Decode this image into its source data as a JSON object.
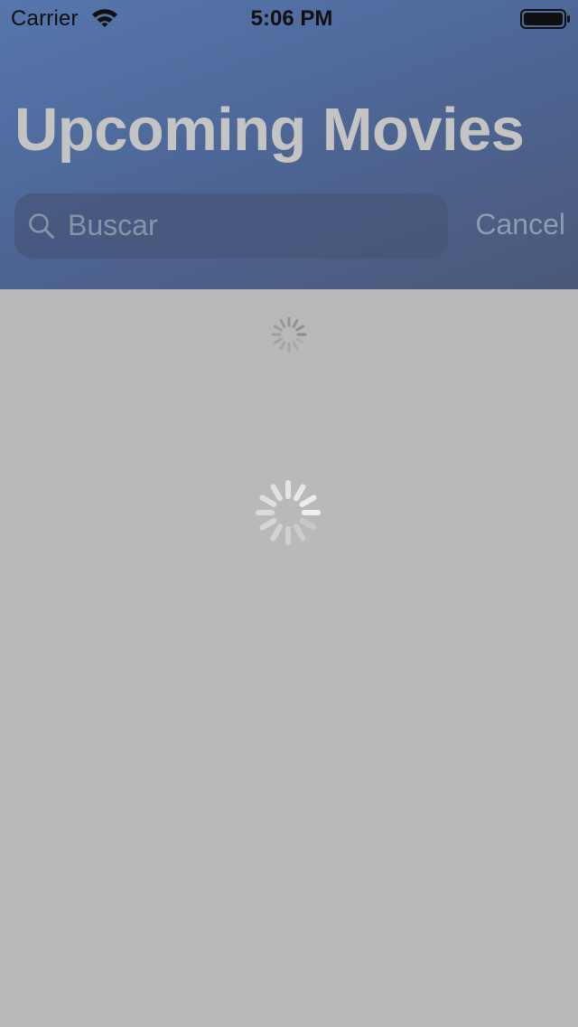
{
  "status_bar": {
    "carrier": "Carrier",
    "time": "5:06 PM",
    "wifi_icon": "wifi-icon",
    "battery_icon": "battery-icon"
  },
  "header": {
    "title": "Upcoming Movies",
    "background_colors": [
      "#5676ad",
      "#4a5878"
    ]
  },
  "search": {
    "placeholder": "Buscar",
    "value": "",
    "icon": "search-icon",
    "cancel_label": "Cancel"
  },
  "content": {
    "background_color": "#b9b9b9",
    "loading_indicators": [
      "activity-spinner-small",
      "activity-spinner-large"
    ]
  }
}
